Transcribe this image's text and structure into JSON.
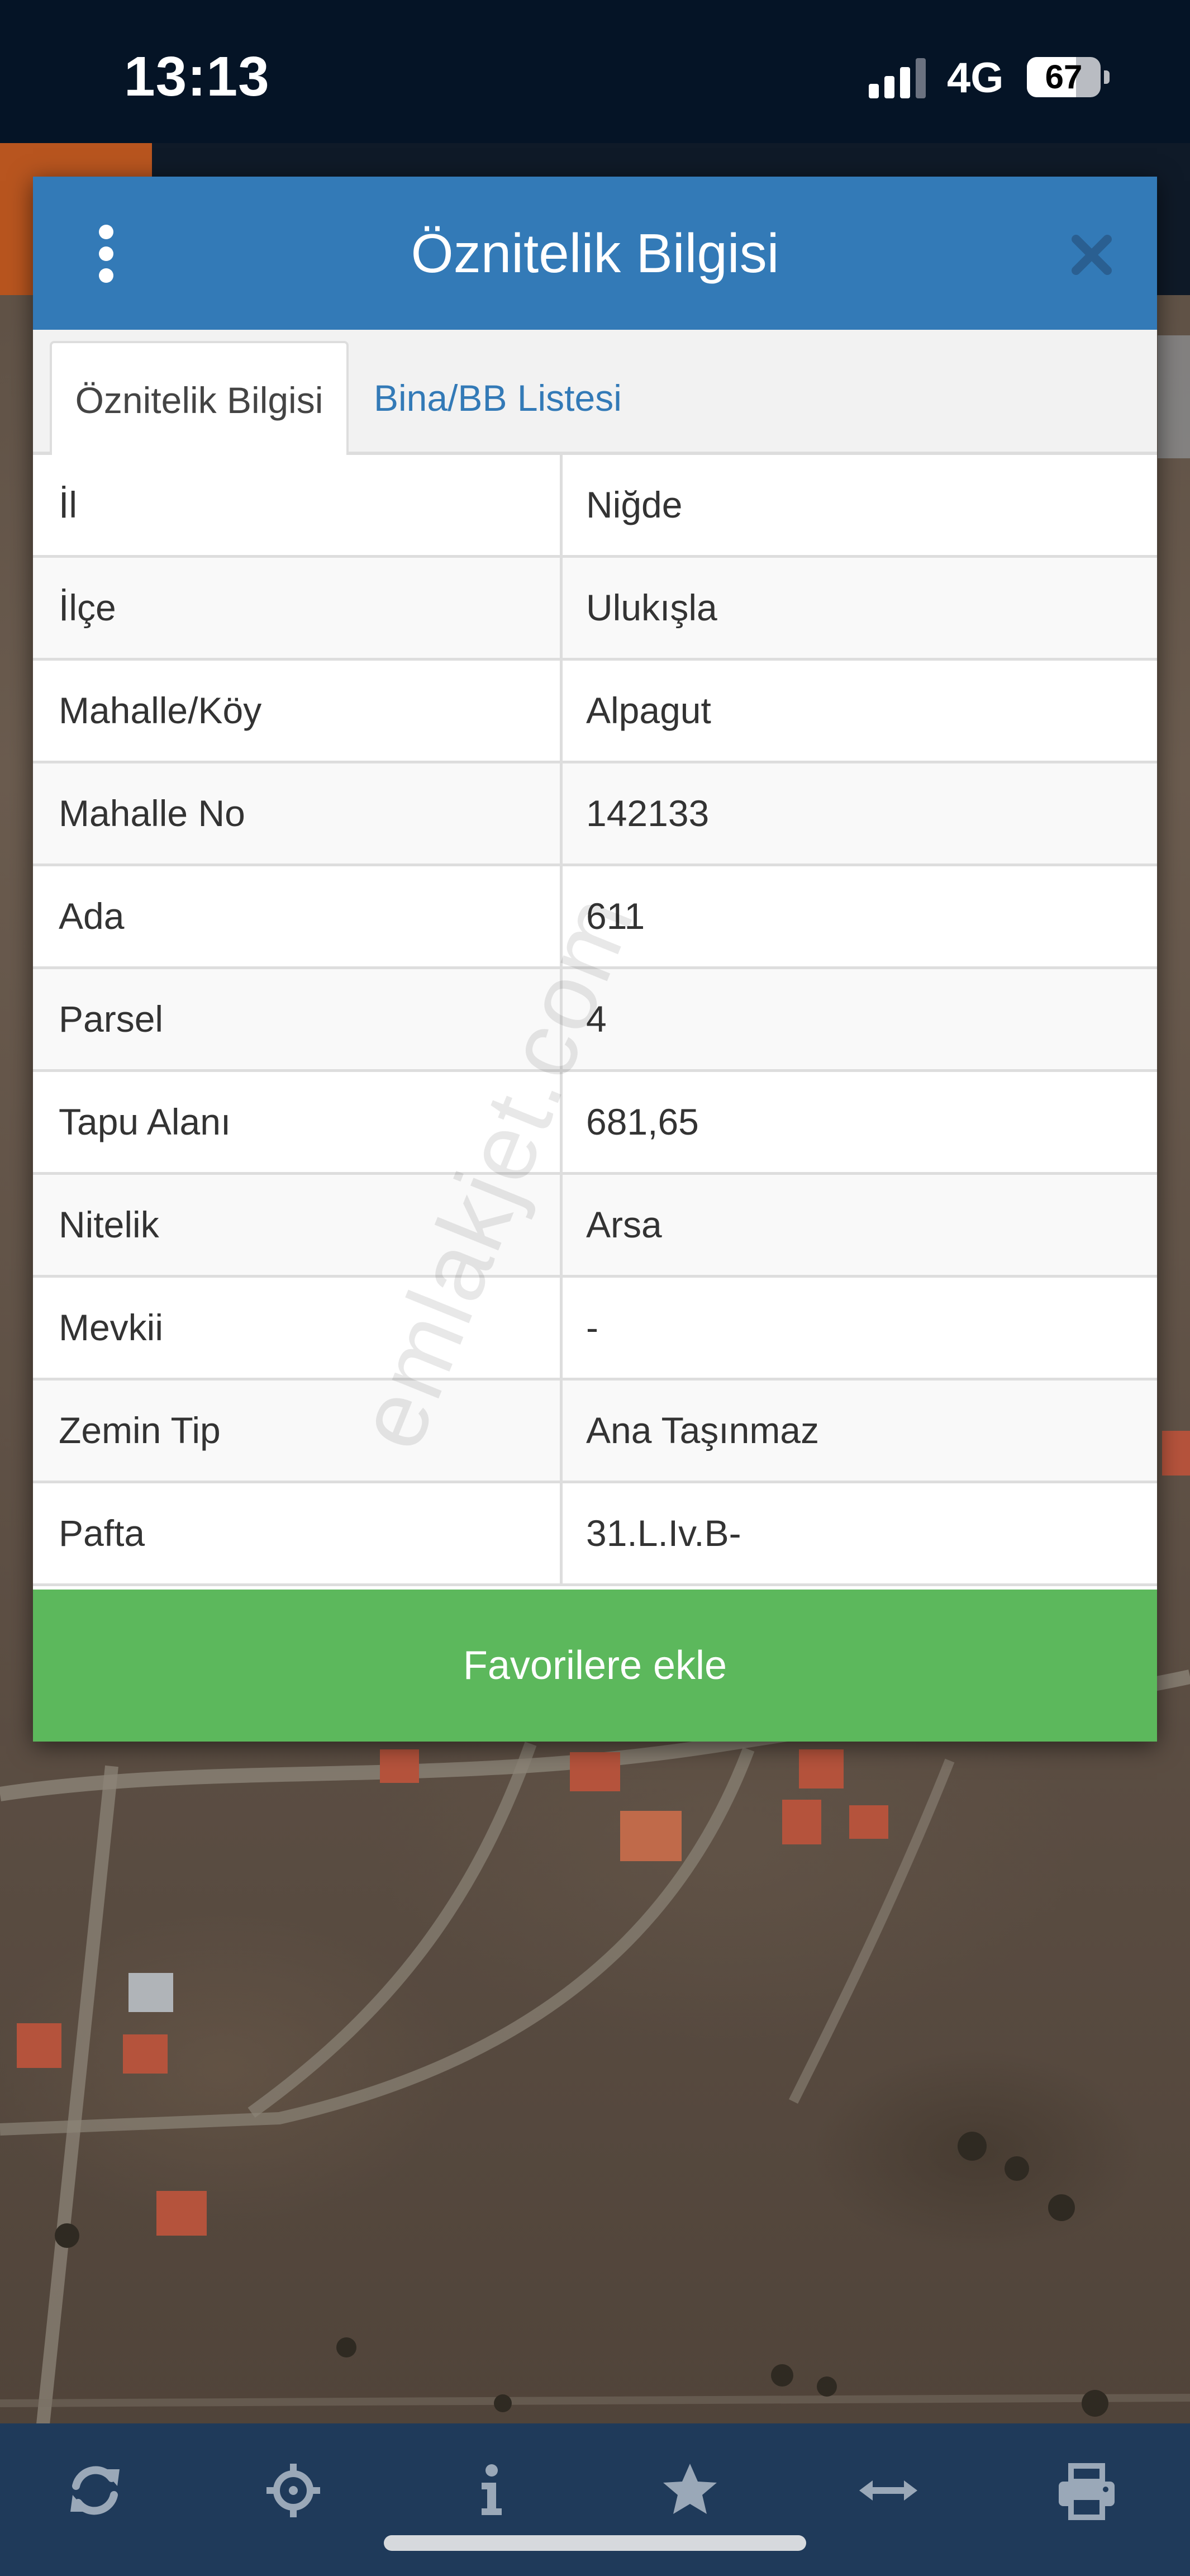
{
  "status_bar": {
    "time": "13:13",
    "network": "4G",
    "battery": "67",
    "battery_level": 0.67
  },
  "dialog": {
    "title": "Öznitelik Bilgisi",
    "menu_icon": "vertical-dots-icon",
    "close_icon": "close-icon",
    "tabs": [
      {
        "label": "Öznitelik Bilgisi",
        "active": true
      },
      {
        "label": "Bina/BB Listesi",
        "active": false
      }
    ],
    "rows": [
      {
        "key": "İl",
        "value": "Niğde"
      },
      {
        "key": "İlçe",
        "value": "Ulukışla"
      },
      {
        "key": "Mahalle/Köy",
        "value": "Alpagut"
      },
      {
        "key": "Mahalle No",
        "value": "142133"
      },
      {
        "key": "Ada",
        "value": "611"
      },
      {
        "key": "Parsel",
        "value": "4"
      },
      {
        "key": "Tapu Alanı",
        "value": "681,65"
      },
      {
        "key": "Nitelik",
        "value": "Arsa"
      },
      {
        "key": "Mevkii",
        "value": "-"
      },
      {
        "key": "Zemin Tip",
        "value": "Ana Taşınmaz"
      },
      {
        "key": "Pafta",
        "value": "31.L.Iv.B-"
      }
    ],
    "favorite_button": "Favorilere ekle"
  },
  "watermark": "emlakjet.com",
  "toolbar": {
    "icons": [
      "refresh-icon",
      "locate-icon",
      "info-icon",
      "star-icon",
      "measure-icon",
      "print-icon"
    ]
  },
  "colors": {
    "header": "#337ab7",
    "favorite": "#5cb85c",
    "status_bar": "#051426",
    "toolbar": "#1f3a5a",
    "accent_orange": "#b8551f"
  }
}
